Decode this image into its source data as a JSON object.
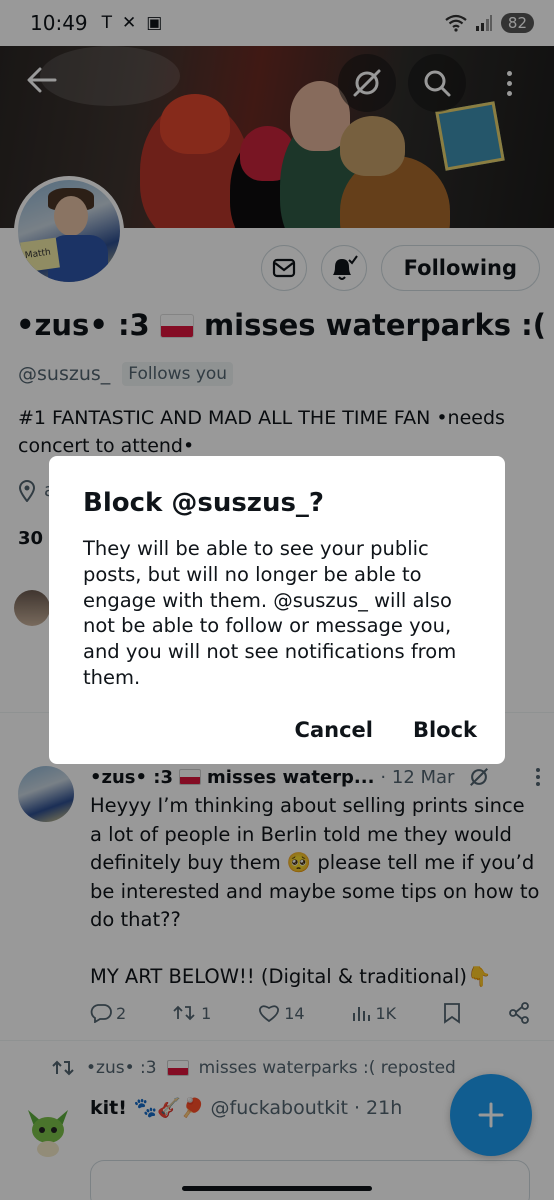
{
  "status_bar": {
    "time": "10:49",
    "battery": "82"
  },
  "profile": {
    "display_name": "•zus• :3",
    "display_name_suffix": "misses waterparks :(",
    "handle": "@suszus_",
    "follows_you": "Follows you",
    "bio": "#1 FANTASTIC AND MAD ALL THE TIME FAN •needs concert to attend•",
    "location_partial": "a",
    "counts_partial": "30",
    "following_button": "Following",
    "avatar_sign_text": "Matth"
  },
  "tweet": {
    "name": "•zus• :3",
    "name_suffix": "misses waterp...",
    "date": "· 12 Mar",
    "body": "Heyyy I’m thinking about selling prints since a lot of people in Berlin told me they would definitely buy them 🥺 please tell me if you’d be interested and maybe some tips on how to do that??\n\nMY ART BELOW!! (Digital & traditional)👇",
    "replies": "2",
    "reposts": "1",
    "likes": "14",
    "views": "1K"
  },
  "repost": {
    "label_name": "•zus• :3",
    "label_suffix": "misses waterparks :( reposted",
    "name": "kit! 🐾🎸🏓",
    "handle_time": "@fuckaboutkit · 21h"
  },
  "dialog": {
    "title": "Block @suszus_?",
    "body": "They will be able to see your public posts, but will no longer be able to engage with them. @suszus_ will also not be able to follow or message you, and you will not see notifications from them.",
    "cancel": "Cancel",
    "block": "Block"
  },
  "colors": {
    "accent": "#1d9bf0",
    "text": "#0f1419",
    "secondary": "#536471",
    "scrim": "rgba(0,0,0,0.40)"
  },
  "icons": [
    "back-arrow-icon",
    "grok-icon",
    "search-icon",
    "more-vertical-icon",
    "mail-icon",
    "bell-check-icon",
    "location-icon",
    "reply-icon",
    "repost-icon",
    "like-icon",
    "views-icon",
    "bookmark-icon",
    "share-icon",
    "compose-plus-icon"
  ]
}
